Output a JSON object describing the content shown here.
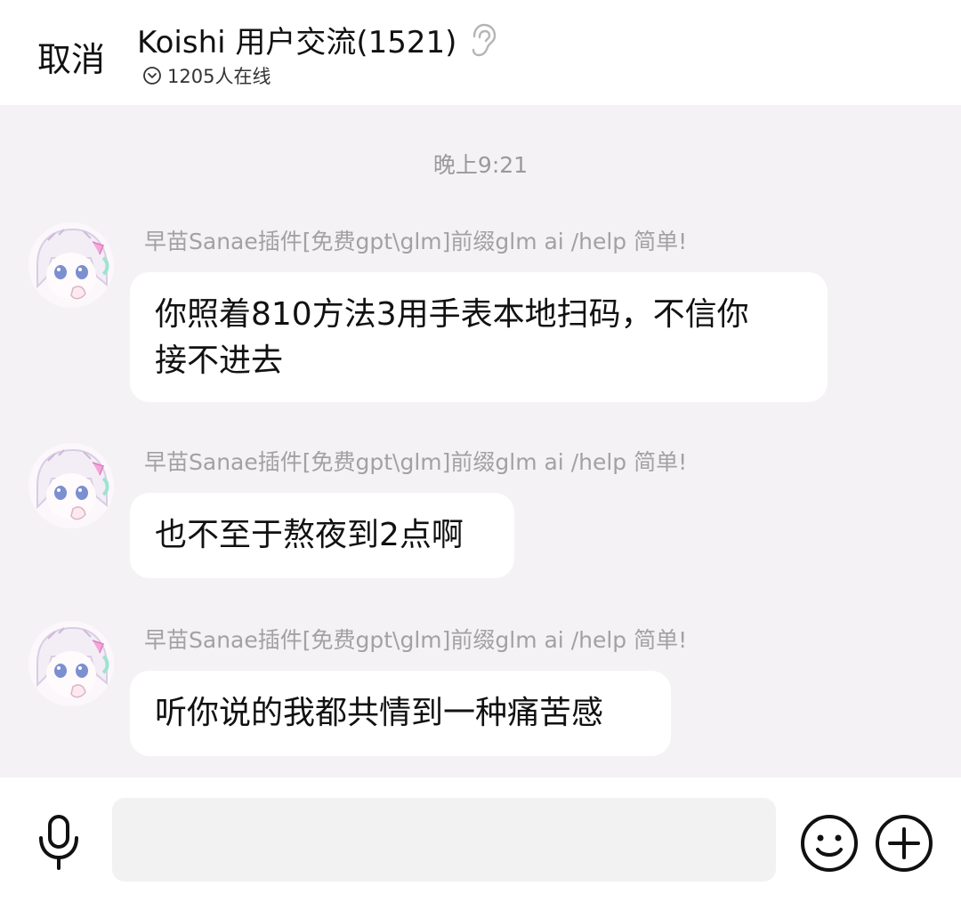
{
  "header": {
    "cancel_label": "取消",
    "title": "Koishi 用户交流(1521)",
    "online_text": "1205人在线"
  },
  "chat": {
    "timestamp": "晚上9:21",
    "messages": [
      {
        "sender": "早苗Sanae插件[免费gpt\\glm]前缀glm ai /help 简单!",
        "text_line1": "你照着810方法3用手表本地扫码，不信你",
        "text_line2": "接不进去"
      },
      {
        "sender": "早苗Sanae插件[免费gpt\\glm]前缀glm ai /help 简单!",
        "text": "也不至于熬夜到2点啊"
      },
      {
        "sender": "早苗Sanae插件[免费gpt\\glm]前缀glm ai /help 简单!",
        "text": "听你说的我都共情到一种痛苦感"
      }
    ]
  },
  "input_bar": {
    "placeholder": "",
    "value": ""
  },
  "icons": {
    "ear": "ear-icon",
    "online": "chevron-down-circle-icon",
    "mic": "microphone-icon",
    "emoji": "smiley-icon",
    "plus": "plus-circle-icon"
  },
  "colors": {
    "background": "#f4f2f5",
    "bubble": "#ffffff",
    "sender_text": "#a2a2a2",
    "timestamp_text": "#9a9a9a"
  }
}
